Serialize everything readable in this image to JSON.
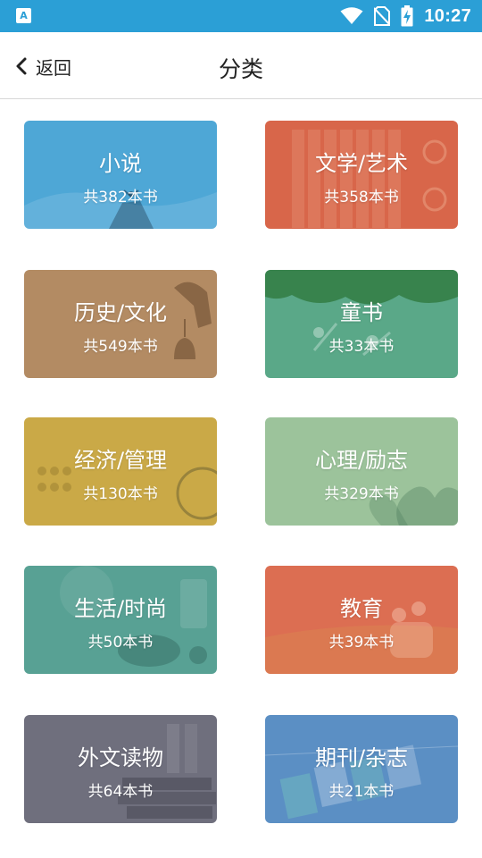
{
  "status_bar": {
    "app_badge": "A",
    "time": "10:27",
    "icons": [
      "wifi-icon",
      "no-sim-icon",
      "battery-charging-icon"
    ]
  },
  "toolbar": {
    "back_label": "返回",
    "title": "分类"
  },
  "categories": [
    {
      "label": "小说",
      "count": "共382本书",
      "color": "#4ea7d6",
      "icon": "mountain-person-image"
    },
    {
      "label": "文学/艺术",
      "count": "共358本书",
      "color": "#d8664a",
      "icon": "bamboo-scroll-image"
    },
    {
      "label": "历史/文化",
      "count": "共549本书",
      "color": "#b38b63",
      "icon": "bronze-bell-image"
    },
    {
      "label": "童书",
      "count": "共33本书",
      "color": "#5aa888",
      "icon": "children-swing-image"
    },
    {
      "label": "经济/管理",
      "count": "共130本书",
      "color": "#caa947",
      "icon": "abacus-globe-image"
    },
    {
      "label": "心理/励志",
      "count": "共329本书",
      "color": "#9cc39b",
      "icon": "heart-hands-image"
    },
    {
      "label": "生活/时尚",
      "count": "共50本书",
      "color": "#58a194",
      "icon": "food-table-image"
    },
    {
      "label": "教育",
      "count": "共39本书",
      "color": "#dc6e52",
      "icon": "family-field-image"
    },
    {
      "label": "外文读物",
      "count": "共64本书",
      "color": "#6f6f7d",
      "icon": "old-books-image"
    },
    {
      "label": "期刊/杂志",
      "count": "共21本书",
      "color": "#5b8fc4",
      "icon": "magazines-image"
    }
  ]
}
